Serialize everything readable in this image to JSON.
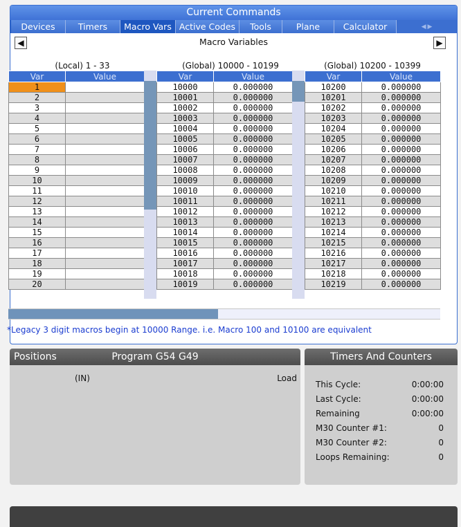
{
  "current_commands": {
    "title": "Current Commands",
    "tabs": [
      {
        "label": "Devices"
      },
      {
        "label": "Timers"
      },
      {
        "label": "Macro Vars"
      },
      {
        "label": "Active Codes"
      },
      {
        "label": "Tools"
      },
      {
        "label": "Plane"
      },
      {
        "label": "Calculator"
      }
    ],
    "active_tab": "Macro Vars",
    "macro_vars_title": "Macro Variables",
    "groups": {
      "local": {
        "title": "(Local) 1 - 33",
        "var_header": "Var",
        "value_header": "Value"
      },
      "global1": {
        "title": "(Global) 10000 - 10199",
        "var_header": "Var",
        "value_header": "Value"
      },
      "global2": {
        "title": "(Global) 10200 - 10399",
        "var_header": "Var",
        "value_header": "Value"
      }
    },
    "local_rows": [
      {
        "var": "1",
        "value": ""
      },
      {
        "var": "2",
        "value": ""
      },
      {
        "var": "3",
        "value": ""
      },
      {
        "var": "4",
        "value": ""
      },
      {
        "var": "5",
        "value": ""
      },
      {
        "var": "6",
        "value": ""
      },
      {
        "var": "7",
        "value": ""
      },
      {
        "var": "8",
        "value": ""
      },
      {
        "var": "9",
        "value": ""
      },
      {
        "var": "10",
        "value": ""
      },
      {
        "var": "11",
        "value": ""
      },
      {
        "var": "12",
        "value": ""
      },
      {
        "var": "13",
        "value": ""
      },
      {
        "var": "14",
        "value": ""
      },
      {
        "var": "15",
        "value": ""
      },
      {
        "var": "16",
        "value": ""
      },
      {
        "var": "17",
        "value": ""
      },
      {
        "var": "18",
        "value": ""
      },
      {
        "var": "19",
        "value": ""
      },
      {
        "var": "20",
        "value": ""
      }
    ],
    "global1_rows": [
      {
        "var": "10000",
        "value": "0.000000"
      },
      {
        "var": "10001",
        "value": "0.000000"
      },
      {
        "var": "10002",
        "value": "0.000000"
      },
      {
        "var": "10003",
        "value": "0.000000"
      },
      {
        "var": "10004",
        "value": "0.000000"
      },
      {
        "var": "10005",
        "value": "0.000000"
      },
      {
        "var": "10006",
        "value": "0.000000"
      },
      {
        "var": "10007",
        "value": "0.000000"
      },
      {
        "var": "10008",
        "value": "0.000000"
      },
      {
        "var": "10009",
        "value": "0.000000"
      },
      {
        "var": "10010",
        "value": "0.000000"
      },
      {
        "var": "10011",
        "value": "0.000000"
      },
      {
        "var": "10012",
        "value": "0.000000"
      },
      {
        "var": "10013",
        "value": "0.000000"
      },
      {
        "var": "10014",
        "value": "0.000000"
      },
      {
        "var": "10015",
        "value": "0.000000"
      },
      {
        "var": "10016",
        "value": "0.000000"
      },
      {
        "var": "10017",
        "value": "0.000000"
      },
      {
        "var": "10018",
        "value": "0.000000"
      },
      {
        "var": "10019",
        "value": "0.000000"
      }
    ],
    "global2_rows": [
      {
        "var": "10200",
        "value": "0.000000"
      },
      {
        "var": "10201",
        "value": "0.000000"
      },
      {
        "var": "10202",
        "value": "0.000000"
      },
      {
        "var": "10203",
        "value": "0.000000"
      },
      {
        "var": "10204",
        "value": "0.000000"
      },
      {
        "var": "10205",
        "value": "0.000000"
      },
      {
        "var": "10206",
        "value": "0.000000"
      },
      {
        "var": "10207",
        "value": "0.000000"
      },
      {
        "var": "10208",
        "value": "0.000000"
      },
      {
        "var": "10209",
        "value": "0.000000"
      },
      {
        "var": "10210",
        "value": "0.000000"
      },
      {
        "var": "10211",
        "value": "0.000000"
      },
      {
        "var": "10212",
        "value": "0.000000"
      },
      {
        "var": "10213",
        "value": "0.000000"
      },
      {
        "var": "10214",
        "value": "0.000000"
      },
      {
        "var": "10215",
        "value": "0.000000"
      },
      {
        "var": "10216",
        "value": "0.000000"
      },
      {
        "var": "10217",
        "value": "0.000000"
      },
      {
        "var": "10218",
        "value": "0.000000"
      },
      {
        "var": "10219",
        "value": "0.000000"
      }
    ],
    "selected_local_var": "1",
    "legacy_note": "*Legacy 3 digit macros begin at 10000 Range.  i.e. Macro 100 and 10100 are equivalent"
  },
  "positions": {
    "title": "Positions",
    "program_title": "Program G54 G49",
    "unit_label": "(IN)",
    "load_label": "Load"
  },
  "timers_counters": {
    "title": "Timers And Counters",
    "rows": [
      {
        "label": "This Cycle:",
        "value": "0:00:00"
      },
      {
        "label": "Last Cycle:",
        "value": "0:00:00"
      },
      {
        "label": "Remaining",
        "value": "0:00:00"
      },
      {
        "label": "M30 Counter #1:",
        "value": "0"
      },
      {
        "label": "M30 Counter #2:",
        "value": "0"
      },
      {
        "label": "Loops Remaining:",
        "value": "0"
      }
    ]
  },
  "colors": {
    "accent_blue": "#3c6fd0",
    "selected_cell": "#f0901a",
    "note_text": "#1a3cd0",
    "panel_header_gray": "#4c4c4c"
  }
}
